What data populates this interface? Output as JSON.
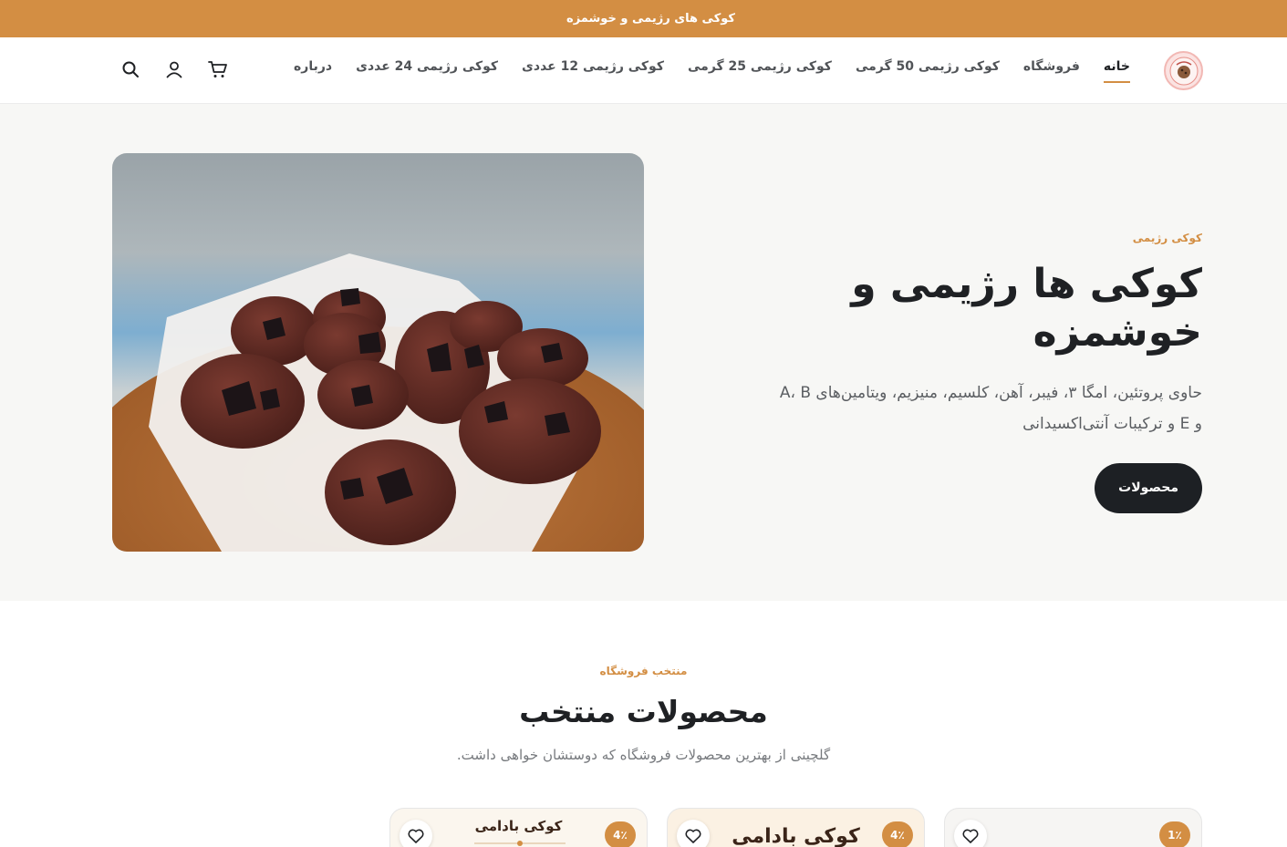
{
  "announcement": {
    "text": "کوکی های رژیمی و خوشمزه"
  },
  "header": {
    "logo_alt": "FIT BITE",
    "nav": [
      {
        "label": "خانه",
        "active": true
      },
      {
        "label": "فروشگاه",
        "active": false
      },
      {
        "label": "کوکی رژیمی 50 گرمی",
        "active": false
      },
      {
        "label": "کوکی رژیمی 25 گرمی",
        "active": false
      },
      {
        "label": "کوکی رژیمی 12 عددی",
        "active": false
      },
      {
        "label": "کوکی رژیمی 24 عددی",
        "active": false
      },
      {
        "label": "درباره",
        "active": false
      }
    ],
    "icons": [
      "search-icon",
      "user-icon",
      "cart-icon"
    ]
  },
  "hero": {
    "kicker": "کوکی رژیمی",
    "title": "کوکی ها رژیمی و خوشمزه",
    "description": "حاوی پروتئین، امگا ۳، فیبر، آهن، کلسیم، منیزیم، ویتامین‌های A، B و E و ترکیبات آنتی‌اکسیدانی",
    "button": "محصولات"
  },
  "featured": {
    "kicker": "منتخب فروشگاه",
    "title": "محصولات منتخب",
    "subtitle": "گلچینی از بهترین محصولات فروشگاه که دوستشان خواهی داشت.",
    "cards": [
      {
        "badge": "1٪",
        "label": ""
      },
      {
        "badge": "4٪",
        "label": "کوکی بادامی"
      },
      {
        "badge": "4٪",
        "label": "کوکی بادامی"
      }
    ]
  },
  "colors": {
    "accent": "#d38e43",
    "dark": "#1d2024",
    "hero_bg": "#f7f7f5"
  }
}
